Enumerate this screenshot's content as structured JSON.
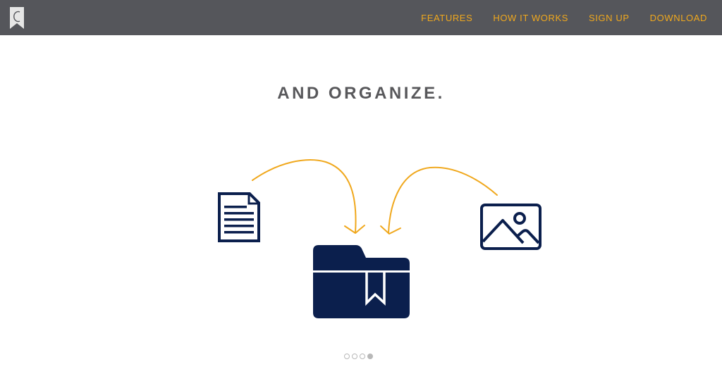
{
  "header": {
    "nav": [
      {
        "label": "FEATURES"
      },
      {
        "label": "HOW IT WORKS"
      },
      {
        "label": "SIGN UP"
      },
      {
        "label": "DOWNLOAD"
      }
    ]
  },
  "main": {
    "headline": "AND ORGANIZE.",
    "icons": [
      "document-icon",
      "folder-bookmark-icon",
      "image-icon",
      "curved-arrow-icon"
    ],
    "carousel": {
      "total": 4,
      "active_index": 3
    }
  },
  "colors": {
    "topbar": "#55565b",
    "accent": "#f0a81d",
    "icon_navy": "#0b1f4d",
    "headline": "#58585b"
  }
}
